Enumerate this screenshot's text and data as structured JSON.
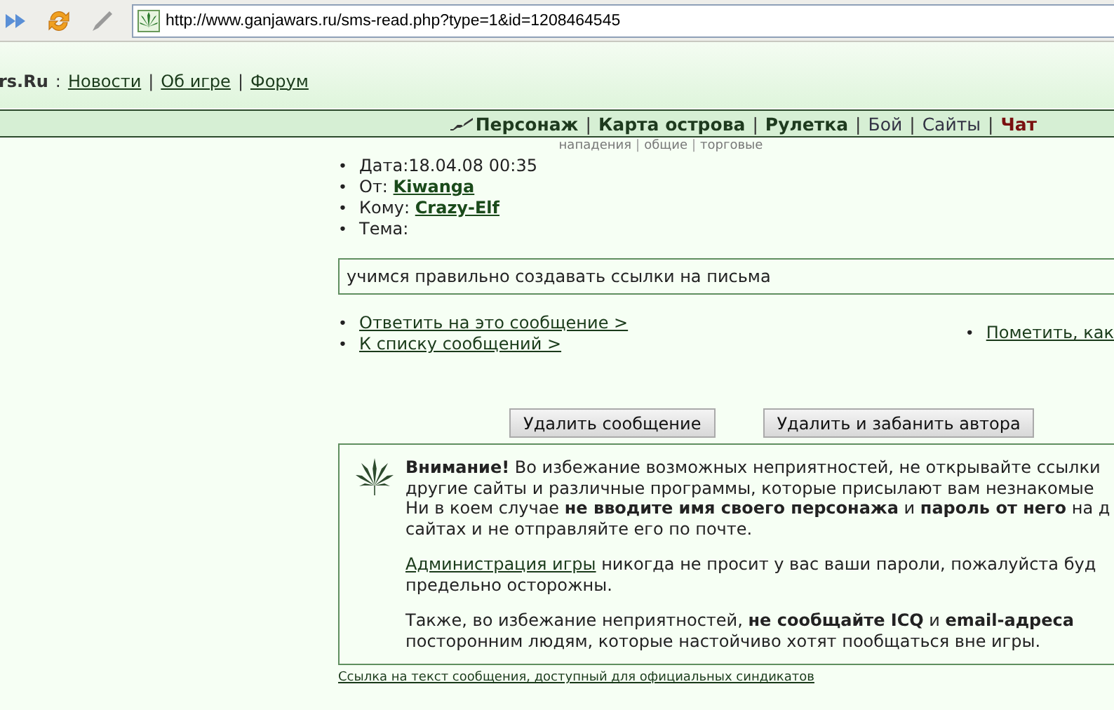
{
  "browser": {
    "url": "http://www.ganjawars.ru/sms-read.php?type=1&id=1208464545"
  },
  "site_header": {
    "title": "rs.Ru",
    "title_separator": ":",
    "link_separator": "|",
    "links": [
      "Новости",
      "Об игре",
      "Форум"
    ]
  },
  "main_nav": {
    "separator": "|",
    "items": [
      {
        "label": "Персонаж",
        "kind": "bold"
      },
      {
        "label": "Карта острова",
        "kind": "bold"
      },
      {
        "label": "Рулетка",
        "kind": "bold"
      },
      {
        "label": "Бой",
        "kind": "plain"
      },
      {
        "label": "Сайты",
        "kind": "plain"
      },
      {
        "label": "Чат",
        "kind": "alert"
      }
    ]
  },
  "sub_nav": {
    "separator": "|",
    "items": [
      "нападения",
      "общие",
      "торговые"
    ]
  },
  "message": {
    "bullet": "•",
    "fields": [
      {
        "label": "Дата:",
        "value": "18.04.08 00:35",
        "kind": "text"
      },
      {
        "label": "От: ",
        "value": "Kiwanga",
        "kind": "link"
      },
      {
        "label": "Кому: ",
        "value": "Crazy-Elf",
        "kind": "link"
      },
      {
        "label": "Тема:"
      }
    ],
    "body": "учимся правильно создавать ссылки на письма",
    "actions": [
      "Ответить на это сообщение >",
      "К списку сообщений >"
    ],
    "side_actions": [
      "Пометить, как"
    ]
  },
  "buttons": [
    "Удалить сообщение",
    "Удалить и забанить автора"
  ],
  "warning": {
    "paragraphs": [
      {
        "lines": [
          "**Внимание!** Во избежание возможных неприятностей, не открывайте ссылки",
          "другие сайты и различные программы, которые присылают вам незнакомые",
          "Ни в коем случае **не вводите имя своего персонажа** и **пароль от него** на д",
          "сайтах и не отправляйте его по почте."
        ]
      },
      {
        "link": "Администрация игры",
        "lines": [
          " никогда не просит у вас ваши пароли, пожалуйста буд",
          "предельно осторожны."
        ]
      },
      {
        "lines": [
          "Также, во избежание неприятностей, **не сообщайте ICQ** и **email-адреса**",
          "посторонним людям, которые настойчиво хотят пообщаться вне игры."
        ]
      }
    ]
  },
  "footer_link": "Ссылка на текст сообщения, доступный для официальных синдикатов"
}
